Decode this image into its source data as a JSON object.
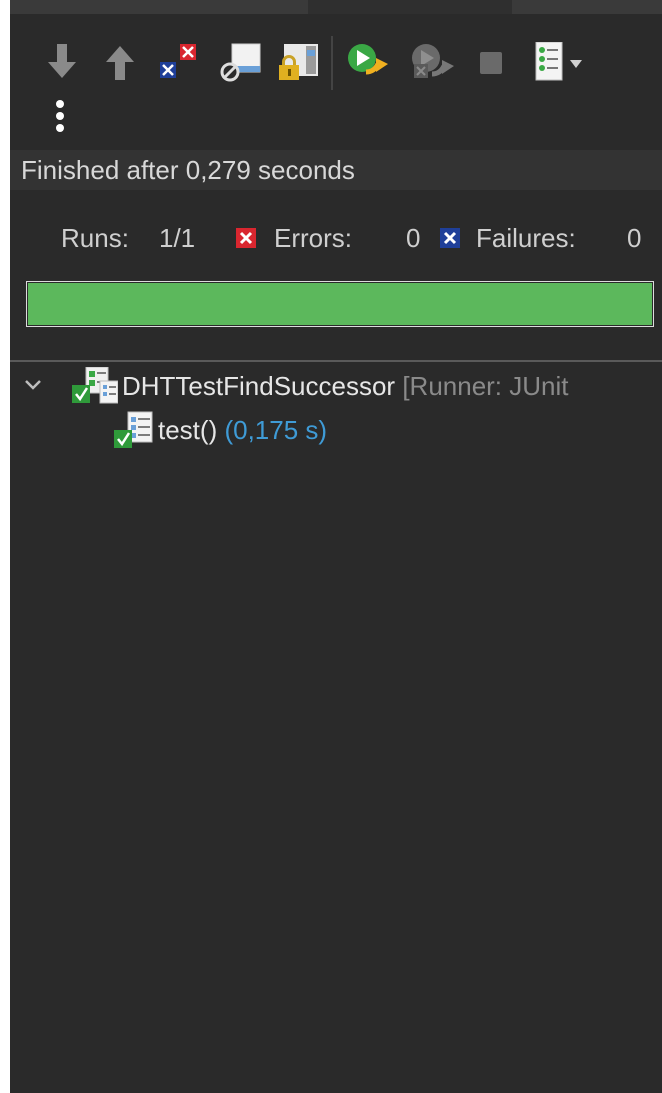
{
  "toolbar": {
    "icons": [
      "next-failure-icon",
      "previous-failure-icon",
      "show-failures-only-icon",
      "show-skipped-tests-icon",
      "scroll-lock-icon",
      "rerun-test-icon",
      "rerun-failures-first-icon",
      "stop-icon",
      "test-run-history-icon",
      "history-dropdown-icon",
      "more-options-icon"
    ]
  },
  "status": {
    "message": "Finished after 0,279 seconds"
  },
  "counters": {
    "runs_label": "Runs:",
    "runs_value": "1/1",
    "errors_label": "Errors:",
    "errors_value": "0",
    "failures_label": "Failures:",
    "failures_value": "0"
  },
  "progress": {
    "fraction": 1.0,
    "color": "#5cb85c"
  },
  "tree": {
    "suite": {
      "name": "DHTTestFindSuccessor",
      "runner": "[Runner: JUnit"
    },
    "test": {
      "name": "test()",
      "time": "(0,175 s)"
    }
  },
  "colors": {
    "background": "#2a2a2a",
    "error_red": "#d9262f",
    "failure_blue": "#1f3f99",
    "time_blue": "#3f9bd6"
  }
}
